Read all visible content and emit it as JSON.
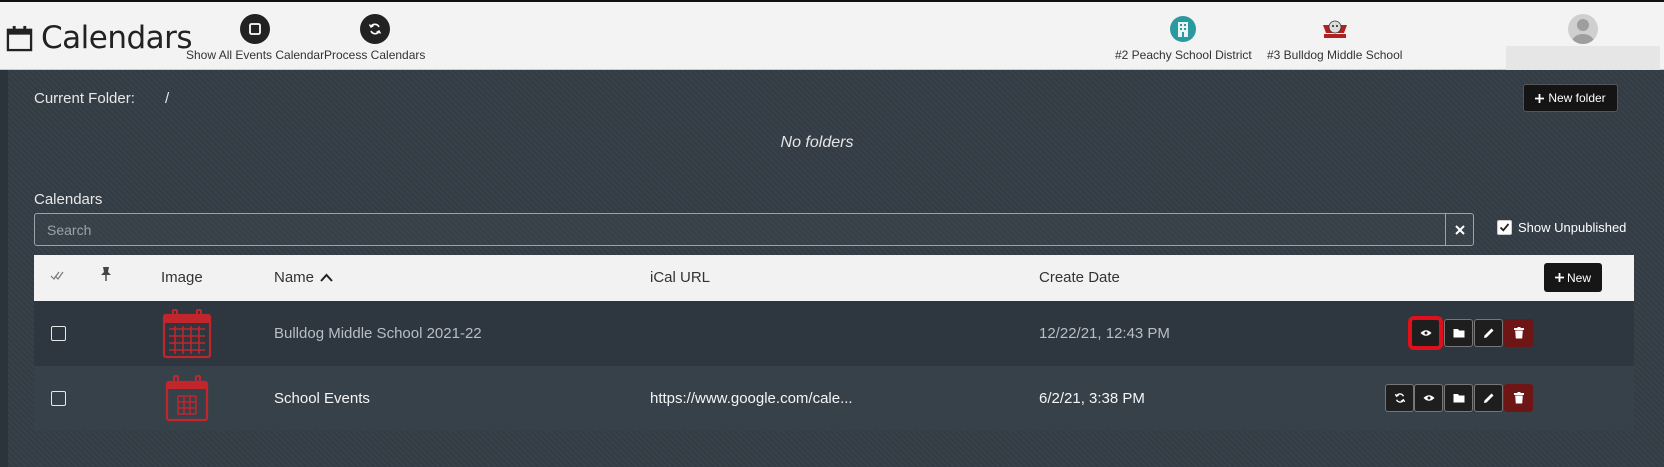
{
  "header": {
    "title": "Calendars",
    "tools": [
      {
        "label": "Show All Events Calendar",
        "icon": "square-icon"
      },
      {
        "label": "Process Calendars",
        "icon": "sync-icon"
      }
    ],
    "orgs": [
      {
        "label": "#2 Peachy School District",
        "icon": "district-logo-icon",
        "color": "#2a9aa0"
      },
      {
        "label": "#3 Bulldog Middle School",
        "icon": "bulldog-logo-icon",
        "color": "#b32020"
      }
    ],
    "user": {
      "icon": "avatar-icon"
    }
  },
  "folders": {
    "current_label": "Current Folder:",
    "path": "/",
    "new_folder_label": "New folder",
    "empty_text": "No folders"
  },
  "calendars": {
    "heading": "Calendars",
    "search_placeholder": "Search",
    "search_value": "",
    "show_unpublished_label": "Show Unpublished",
    "show_unpublished_checked": true,
    "columns": {
      "image": "Image",
      "name": "Name",
      "ical": "iCal URL",
      "created": "Create Date"
    },
    "sort": {
      "column": "Name",
      "direction": "ascending"
    },
    "new_label": "New",
    "rows": [
      {
        "name": "Bulldog Middle School 2021-22",
        "ical_url": "",
        "created": "12/22/21, 12:43 PM",
        "published": false,
        "actions": [
          "view-icon",
          "folder-icon",
          "edit-icon",
          "delete-icon"
        ]
      },
      {
        "name": "School Events",
        "ical_url": "https://www.google.com/cale...",
        "created": "6/2/21, 3:38 PM",
        "published": true,
        "actions": [
          "sync-icon",
          "view-icon",
          "folder-icon",
          "edit-icon",
          "delete-icon"
        ]
      }
    ]
  },
  "colors": {
    "accent_red": "#c0262c",
    "background": "#343d45",
    "highlight": "#e0101a"
  }
}
